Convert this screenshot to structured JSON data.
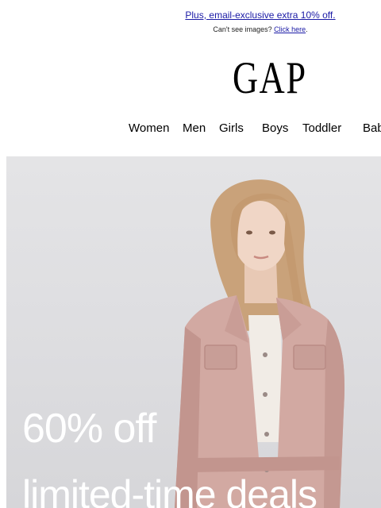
{
  "preheader": {
    "promo_text": "Plus, email-exclusive extra 10% off.",
    "cant_see_text": "Can't see images?",
    "click_here": "Click here",
    "period": "."
  },
  "brand": {
    "logo_text": "GAP"
  },
  "nav": {
    "items": [
      "Women",
      "Men",
      "Girls",
      "Boys",
      "Toddler",
      "Baby"
    ]
  },
  "hero": {
    "headline": "60% off",
    "subheadline": "limited-time deals"
  },
  "colors": {
    "link": "#1a1aa6",
    "hero_background": "#e0e0e3",
    "jacket_pink": "#d2a9a2",
    "hero_text": "#ffffff"
  }
}
